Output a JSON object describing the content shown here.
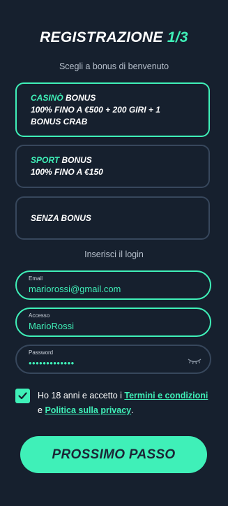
{
  "header": {
    "title": "REGISTRAZIONE",
    "step": "1/3",
    "subtitle": "Scegli a bonus di benvenuto"
  },
  "bonuses": [
    {
      "accent": "CASINÒ",
      "label": "BONUS",
      "line2": "100% FINO A €500 + 200 GIRI + 1",
      "line3": "BONUS CRAB",
      "selected": true
    },
    {
      "accent": "SPORT",
      "label": "BONUS",
      "line2": "100% FINO A €150",
      "selected": false
    },
    {
      "label": "SENZA BONUS",
      "selected": false
    }
  ],
  "login": {
    "section_label": "Inserisci il login",
    "email": {
      "label": "Email",
      "value": "mariorossi@gmail.com"
    },
    "username": {
      "label": "Accesso",
      "value": "MarioRossi"
    },
    "password": {
      "label": "Password",
      "value": "•••••••••••••",
      "icon": "eye-closed-icon"
    }
  },
  "consent": {
    "checked": true,
    "text_before": "Ho 18 anni e accetto i ",
    "terms_link": "Termini e condizioni",
    "text_middle": "e ",
    "privacy_link": "Politica sulla privacy",
    "text_after": "."
  },
  "cta": {
    "label": "PROSSIMO PASSO"
  },
  "colors": {
    "background": "#16202e",
    "accent": "#3ff0b8",
    "border_muted": "#37475c",
    "button_text": "#1b2536"
  }
}
